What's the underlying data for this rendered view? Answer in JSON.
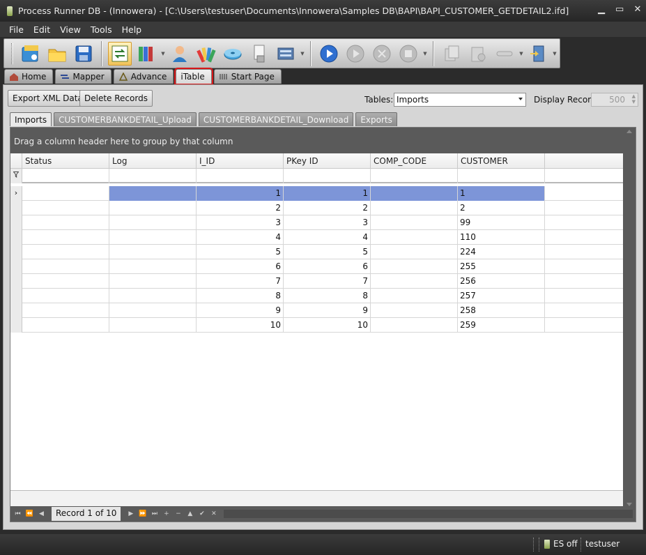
{
  "window": {
    "title": "Process Runner DB - (Innowera) - [C:\\Users\\testuser\\Documents\\Innowera\\Samples DB\\BAPI\\BAPI_CUSTOMER_GETDETAIL2.ifd]",
    "controls": {
      "minimize": "▁",
      "restore": "▭",
      "close": "✕"
    }
  },
  "menu": [
    "File",
    "Edit",
    "View",
    "Tools",
    "Help"
  ],
  "toolbar": {
    "groups": [
      [
        "open-wizard-icon",
        "folder-open-icon",
        "save-disk-icon",
        "mapper-arrows-icon",
        "books-icon",
        "user-icon",
        "color-palette-icon",
        "database-disc-icon",
        "document-lock-icon",
        "server-icon"
      ],
      [
        "play-icon",
        "play-disabled-icon",
        "stop-disabled-icon",
        "pause-disabled-icon"
      ],
      [
        "copy-disabled-icon",
        "paste-disabled-icon",
        "link-disabled-icon",
        "export-icon"
      ]
    ]
  },
  "main_tabs": [
    {
      "label": "Home",
      "icon": "home-icon"
    },
    {
      "label": "Mapper",
      "icon": "mapper-icon"
    },
    {
      "label": "Advance",
      "icon": "advance-icon"
    },
    {
      "label": "iTable",
      "icon": "",
      "selected": true
    },
    {
      "label": "Start Page",
      "icon": "start-page-icon"
    }
  ],
  "actions": {
    "export_xml": "Export XML Data",
    "delete_records": "Delete Records"
  },
  "tables": {
    "label": "Tables:",
    "value": "Imports"
  },
  "display_records": {
    "label": "Display Records",
    "value": "500"
  },
  "sub_tabs": [
    {
      "label": "Imports",
      "selected": true
    },
    {
      "label": "CUSTOMERBANKDETAIL_Upload"
    },
    {
      "label": "CUSTOMERBANKDETAIL_Download"
    },
    {
      "label": "Exports"
    }
  ],
  "grid": {
    "group_hint": "Drag a column header here to group by that column",
    "columns": [
      "Status",
      "Log",
      "I_ID",
      "PKey ID",
      "COMP_CODE",
      "CUSTOMER"
    ],
    "rows": [
      {
        "status": "",
        "log": "",
        "i_id": "1",
        "pkey": "1",
        "comp": "",
        "customer": "1",
        "current": true
      },
      {
        "status": "",
        "log": "",
        "i_id": "2",
        "pkey": "2",
        "comp": "",
        "customer": "2"
      },
      {
        "status": "",
        "log": "",
        "i_id": "3",
        "pkey": "3",
        "comp": "",
        "customer": "99"
      },
      {
        "status": "",
        "log": "",
        "i_id": "4",
        "pkey": "4",
        "comp": "",
        "customer": "110"
      },
      {
        "status": "",
        "log": "",
        "i_id": "5",
        "pkey": "5",
        "comp": "",
        "customer": "224"
      },
      {
        "status": "",
        "log": "",
        "i_id": "6",
        "pkey": "6",
        "comp": "",
        "customer": "255"
      },
      {
        "status": "",
        "log": "",
        "i_id": "7",
        "pkey": "7",
        "comp": "",
        "customer": "256"
      },
      {
        "status": "",
        "log": "",
        "i_id": "8",
        "pkey": "8",
        "comp": "",
        "customer": "257"
      },
      {
        "status": "",
        "log": "",
        "i_id": "9",
        "pkey": "9",
        "comp": "",
        "customer": "258"
      },
      {
        "status": "",
        "log": "",
        "i_id": "10",
        "pkey": "10",
        "comp": "",
        "customer": "259"
      }
    ],
    "navigator": {
      "record_text": "Record 1 of 10",
      "buttons": [
        "⏮",
        "⏪",
        "◀",
        "▶",
        "⏩",
        "⏭",
        "+",
        "−",
        "▲",
        "✔",
        "✕"
      ]
    }
  },
  "status": {
    "es": "ES off",
    "user": "testuser"
  },
  "colors": {
    "selected_cell": "#7d95d8",
    "highlight_border": "#d9181a"
  }
}
